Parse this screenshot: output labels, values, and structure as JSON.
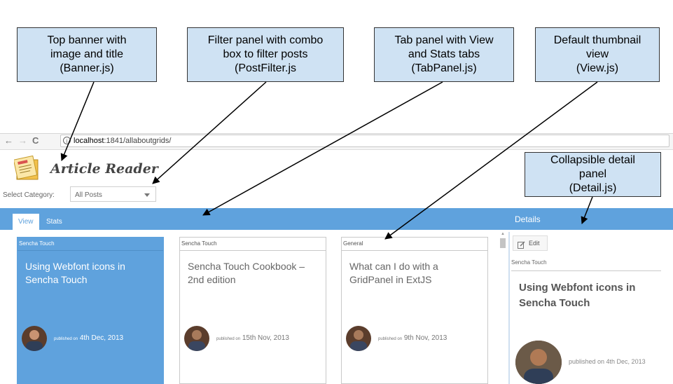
{
  "callouts": [
    {
      "id": "banner",
      "text": "Top banner with\nimage and title\n(Banner.js)"
    },
    {
      "id": "filter",
      "text": "Filter panel with combo\nbox to filter posts\n(PostFilter.js"
    },
    {
      "id": "tabpanel",
      "text": "Tab panel with View\nand Stats tabs\n(TabPanel.js)"
    },
    {
      "id": "view",
      "text": "Default thumbnail\nview\n(View.js)"
    },
    {
      "id": "detail",
      "text": "Collapsible detail\npanel\n(Detail.js)"
    }
  ],
  "browser": {
    "back_glyph": "←",
    "forward_glyph": "→",
    "reload_glyph": "C",
    "info_glyph": "i",
    "url_host": "localhost",
    "url_rest": ":1841/allaboutgrids/"
  },
  "banner": {
    "title": "Article Reader",
    "logo_icon": "newspaper-icon"
  },
  "filter": {
    "label": "Select Category:",
    "selected": "All Posts"
  },
  "tabs": [
    {
      "label": "View",
      "active": true
    },
    {
      "label": "Stats",
      "active": false
    }
  ],
  "details": {
    "header": "Details",
    "edit_label": "Edit",
    "category": "Sencha Touch",
    "title": "Using Webfont icons in Sencha Touch",
    "published": "published on 4th Dec, 2013"
  },
  "cards": [
    {
      "category": "Sencha Touch",
      "title": "Using Webfont icons in Sencha Touch",
      "pub_prefix": "published on",
      "pub_date": "4th Dec, 2013",
      "selected": true
    },
    {
      "category": "Sencha Touch",
      "title": "Sencha Touch Cookbook – 2nd edition",
      "pub_prefix": "published on",
      "pub_date": "15th Nov, 2013",
      "selected": false
    },
    {
      "category": "General",
      "title": "What can I do with a GridPanel in ExtJS",
      "pub_prefix": "published on",
      "pub_date": "9th Nov, 2013",
      "selected": false
    }
  ],
  "colors": {
    "accent": "#5fa2dd",
    "callout_bg": "#cfe2f3"
  }
}
